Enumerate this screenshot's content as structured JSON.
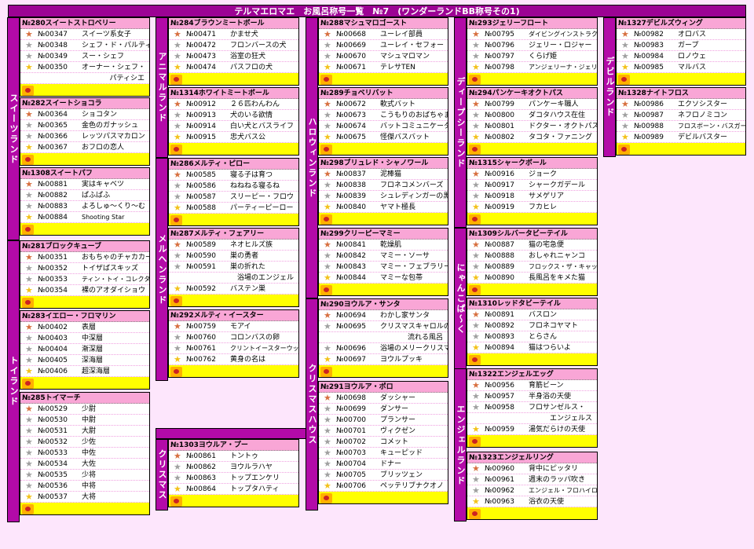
{
  "title": "テルマエロマエ　お風呂称号一覧　№7　(ワンダーランドBB称号その1)",
  "icons": {
    "bronze": "bronze-star-icon",
    "silver": "silver-star-icon",
    "gold": "gold-star-icon",
    "crown": "crown-icon"
  },
  "sides": {
    "s1": "スイーツランド",
    "s2": "トイランド",
    "s3": "アニマルランド",
    "s4": "メルヘンランド",
    "s5": "クリスマス",
    "s6": "ハロウィンランド",
    "s7": "クリスマスハウス",
    "s8": "ディープシーランド",
    "s9": "にゃんこぱ〜く",
    "s10": "エンジェルランド",
    "s11": "デビルランド"
  },
  "groups": {
    "g280": {
      "title": "№280スイートストロベリー",
      "items": [
        {
          "no": "№00347",
          "name": "スイーツ系女子"
        },
        {
          "no": "№00348",
          "name": "シェフ・ド・パルティ"
        },
        {
          "no": "№00349",
          "name": "スー・シェフ"
        },
        {
          "no": "№00350",
          "name": "オーナー・シェフ・",
          "cont": "パティシエ"
        }
      ]
    },
    "g282": {
      "title": "№282スイートショコラ",
      "items": [
        {
          "no": "№00364",
          "name": "ショコタン"
        },
        {
          "no": "№00365",
          "name": "金色のガナッシュ"
        },
        {
          "no": "№00366",
          "name": "レッツパスマカロン"
        },
        {
          "no": "№00367",
          "name": "おフロの恋人"
        }
      ]
    },
    "g1308": {
      "title": "№1308スイートパフ",
      "items": [
        {
          "no": "№00881",
          "name": "実はキャベツ"
        },
        {
          "no": "№00882",
          "name": "ぱふぱふ"
        },
        {
          "no": "№00883",
          "name": "よろしゅ〜くり〜む"
        },
        {
          "no": "№00884",
          "name": "Shooting Star"
        }
      ]
    },
    "g281": {
      "title": "№281ブロックキューブ",
      "items": [
        {
          "no": "№00351",
          "name": "おもちゃのチャカカーン"
        },
        {
          "no": "№00352",
          "name": "トイザばスキッズ"
        },
        {
          "no": "№00353",
          "name": "ティン・トイ・コレクター"
        },
        {
          "no": "№00354",
          "name": "裸のアオダイショウ"
        }
      ]
    },
    "g283": {
      "title": "№283イエロー・フロマリン",
      "items": [
        {
          "no": "№00402",
          "name": "表層"
        },
        {
          "no": "№00403",
          "name": "中深層"
        },
        {
          "no": "№00404",
          "name": "漸深層"
        },
        {
          "no": "№00405",
          "name": "深海層"
        },
        {
          "no": "№00406",
          "name": "超深海層"
        }
      ]
    },
    "g285": {
      "title": "№285トイマーチ",
      "items": [
        {
          "no": "№00529",
          "name": "少尉"
        },
        {
          "no": "№00530",
          "name": "中尉"
        },
        {
          "no": "№00531",
          "name": "大尉"
        },
        {
          "no": "№00532",
          "name": "少佐"
        },
        {
          "no": "№00533",
          "name": "中佐"
        },
        {
          "no": "№00534",
          "name": "大佐"
        },
        {
          "no": "№00535",
          "name": "少将"
        },
        {
          "no": "№00536",
          "name": "中将"
        },
        {
          "no": "№00537",
          "name": "大将"
        }
      ]
    },
    "g284": {
      "title": "№284ブラウンミートボール",
      "items": [
        {
          "no": "№00471",
          "name": "かませ犬"
        },
        {
          "no": "№00472",
          "name": "フロンバースの犬"
        },
        {
          "no": "№00473",
          "name": "浴室の狂犬"
        },
        {
          "no": "№00474",
          "name": "パスフロの犬"
        }
      ]
    },
    "g1314": {
      "title": "№1314ホワイトミートボール",
      "items": [
        {
          "no": "№00912",
          "name": "２６匹わんわん"
        },
        {
          "no": "№00913",
          "name": "犬のいる欲情"
        },
        {
          "no": "№00914",
          "name": "白い犬とバスライフ"
        },
        {
          "no": "№00915",
          "name": "忠犬バス公"
        }
      ]
    },
    "g286": {
      "title": "№286メルティ・ピロー",
      "items": [
        {
          "no": "№00585",
          "name": "寝る子は育つ"
        },
        {
          "no": "№00586",
          "name": "ねねねる寝るね"
        },
        {
          "no": "№00587",
          "name": "スリーピー・フロウ"
        },
        {
          "no": "№00588",
          "name": "パーティーピーロー"
        }
      ]
    },
    "g287": {
      "title": "№287メルティ・フェアリー",
      "items": [
        {
          "no": "№00589",
          "name": "ネオヒルズ族"
        },
        {
          "no": "№00590",
          "name": "巣の勇者"
        },
        {
          "no": "№00591",
          "name": "巣の折れた",
          "cont": "浴場のエンジェル"
        },
        {
          "no": "№00592",
          "name": "バステン巣"
        }
      ]
    },
    "g292": {
      "title": "№292メルティ・イースター",
      "items": [
        {
          "no": "№00759",
          "name": "モアイ"
        },
        {
          "no": "№00760",
          "name": "コロンバスの卵"
        },
        {
          "no": "№00761",
          "name": "クリントイースターウッド"
        },
        {
          "no": "№00762",
          "name": "黄身の名は"
        }
      ]
    },
    "g1303": {
      "title": "№1303ヨウルア・プー",
      "items": [
        {
          "no": "№00861",
          "name": "トントゥ"
        },
        {
          "no": "№00862",
          "name": "ヨウルラハヤ"
        },
        {
          "no": "№00863",
          "name": "トップエンケリ"
        },
        {
          "no": "№00864",
          "name": "トップタハティ"
        }
      ]
    },
    "g288": {
      "title": "№288マシュマロゴースト",
      "items": [
        {
          "no": "№00668",
          "name": "ユーレイ部員"
        },
        {
          "no": "№00669",
          "name": "ユーレイ・セフォー"
        },
        {
          "no": "№00670",
          "name": "マシュマロマン"
        },
        {
          "no": "№00671",
          "name": "テレサTEN"
        }
      ]
    },
    "g289": {
      "title": "№289チョベリバット",
      "items": [
        {
          "no": "№00672",
          "name": "軟式バット"
        },
        {
          "no": "№00673",
          "name": "こうもりのおばちゃま"
        },
        {
          "no": "№00674",
          "name": "バットコミュニケーター"
        },
        {
          "no": "№00675",
          "name": "怪傑バスバット"
        }
      ]
    },
    "g298": {
      "title": "№298ブリュレド・シャノワール",
      "items": [
        {
          "no": "№00837",
          "name": "泥棒猫"
        },
        {
          "no": "№00838",
          "name": "フロネコメンバーズ"
        },
        {
          "no": "№00839",
          "name": "シュレディンガーの黒猫"
        },
        {
          "no": "№00840",
          "name": "ヤマト極長"
        }
      ]
    },
    "g299": {
      "title": "№299クリーピーマミー",
      "items": [
        {
          "no": "№00841",
          "name": "乾燥肌"
        },
        {
          "no": "№00842",
          "name": "マミー・ソーサ"
        },
        {
          "no": "№00843",
          "name": "マミー・フェブラリー"
        },
        {
          "no": "№00844",
          "name": "マミーな包帯"
        }
      ]
    },
    "g290": {
      "title": "№290ヨウルア・サンタ",
      "items": [
        {
          "no": "№00694",
          "name": "わかし家サンタ"
        },
        {
          "no": "№00695",
          "name": "クリスマスキャロルの",
          "cont": "流れる風呂"
        },
        {
          "no": "№00696",
          "name": "浴場のメリークリスマス"
        },
        {
          "no": "№00697",
          "name": "ヨウルプッキ"
        }
      ]
    },
    "g291": {
      "title": "№291ヨウルア・ポロ",
      "items": [
        {
          "no": "№00698",
          "name": "ダッシャー"
        },
        {
          "no": "№00699",
          "name": "ダンサー"
        },
        {
          "no": "№00700",
          "name": "プランサー"
        },
        {
          "no": "№00701",
          "name": "ヴィクゼン"
        },
        {
          "no": "№00702",
          "name": "コメット"
        },
        {
          "no": "№00703",
          "name": "キューピッド"
        },
        {
          "no": "№00704",
          "name": "ドナー"
        },
        {
          "no": "№00705",
          "name": "ブリッツェン"
        },
        {
          "no": "№00706",
          "name": "ペッテリブナクオノ"
        }
      ]
    },
    "g293": {
      "title": "№293ジェリーフロート",
      "items": [
        {
          "no": "№00795",
          "name": "ダイビングインストラクター"
        },
        {
          "no": "№00796",
          "name": "ジェリー・ロジャー"
        },
        {
          "no": "№00797",
          "name": "くらげ姫"
        },
        {
          "no": "№00798",
          "name": "アンジェリーナ・ジェリー"
        }
      ]
    },
    "g294": {
      "title": "№294パンケーキオクトパス",
      "items": [
        {
          "no": "№00799",
          "name": "パンケーキ職人"
        },
        {
          "no": "№00800",
          "name": "ダコタハウス在住"
        },
        {
          "no": "№00801",
          "name": "ドクター・オクトパス"
        },
        {
          "no": "№00802",
          "name": "タコタ・ファニング"
        }
      ]
    },
    "g1315": {
      "title": "№1315シャークボール",
      "items": [
        {
          "no": "№00916",
          "name": "ジョーク"
        },
        {
          "no": "№00917",
          "name": "シャークガデール"
        },
        {
          "no": "№00918",
          "name": "サメゲリア"
        },
        {
          "no": "№00919",
          "name": "フカヒレ"
        }
      ]
    },
    "g1309": {
      "title": "№1309シルバータビーテイル",
      "items": [
        {
          "no": "№00887",
          "name": "猫の宅急便"
        },
        {
          "no": "№00888",
          "name": "おしゃれニャンコ"
        },
        {
          "no": "№00889",
          "name": "フロックス・ザ・キャット"
        },
        {
          "no": "№00890",
          "name": "長風呂をキメた猫"
        }
      ]
    },
    "g1310": {
      "title": "№1310レッドタビーテイル",
      "items": [
        {
          "no": "№00891",
          "name": "バスロン"
        },
        {
          "no": "№00892",
          "name": "フロネコヤマト"
        },
        {
          "no": "№00893",
          "name": "とらさん"
        },
        {
          "no": "№00894",
          "name": "猫はつらいよ"
        }
      ]
    },
    "g1322": {
      "title": "№1322エンジェルエッグ",
      "items": [
        {
          "no": "№00956",
          "name": "育筋ビーン"
        },
        {
          "no": "№00957",
          "name": "半身浴の天使"
        },
        {
          "no": "№00958",
          "name": "フロサンゼルス・",
          "cont": "エンジェルス"
        },
        {
          "no": "№00959",
          "name": "湯気だらけの天使"
        }
      ]
    },
    "g1323": {
      "title": "№1323エンジェルリング",
      "items": [
        {
          "no": "№00960",
          "name": "背中にピッタリ"
        },
        {
          "no": "№00961",
          "name": "週末のラッパ吹き"
        },
        {
          "no": "№00962",
          "name": "エンジェル・フロハイロゥ"
        },
        {
          "no": "№00963",
          "name": "浴衣の天使"
        }
      ]
    },
    "g1327": {
      "title": "№1327デビルズウィング",
      "items": [
        {
          "no": "№00982",
          "name": "オロバス"
        },
        {
          "no": "№00983",
          "name": "ガープ"
        },
        {
          "no": "№00984",
          "name": "ロノウェ"
        },
        {
          "no": "№00985",
          "name": "マルバス"
        }
      ]
    },
    "g1328": {
      "title": "№1328ナイトフロス",
      "items": [
        {
          "no": "№00986",
          "name": "エクソシスター"
        },
        {
          "no": "№00987",
          "name": "ネフロノミコン"
        },
        {
          "no": "№00988",
          "name": "フロスボーン・バスガード"
        },
        {
          "no": "№00989",
          "name": "デビルバスター"
        }
      ]
    }
  }
}
